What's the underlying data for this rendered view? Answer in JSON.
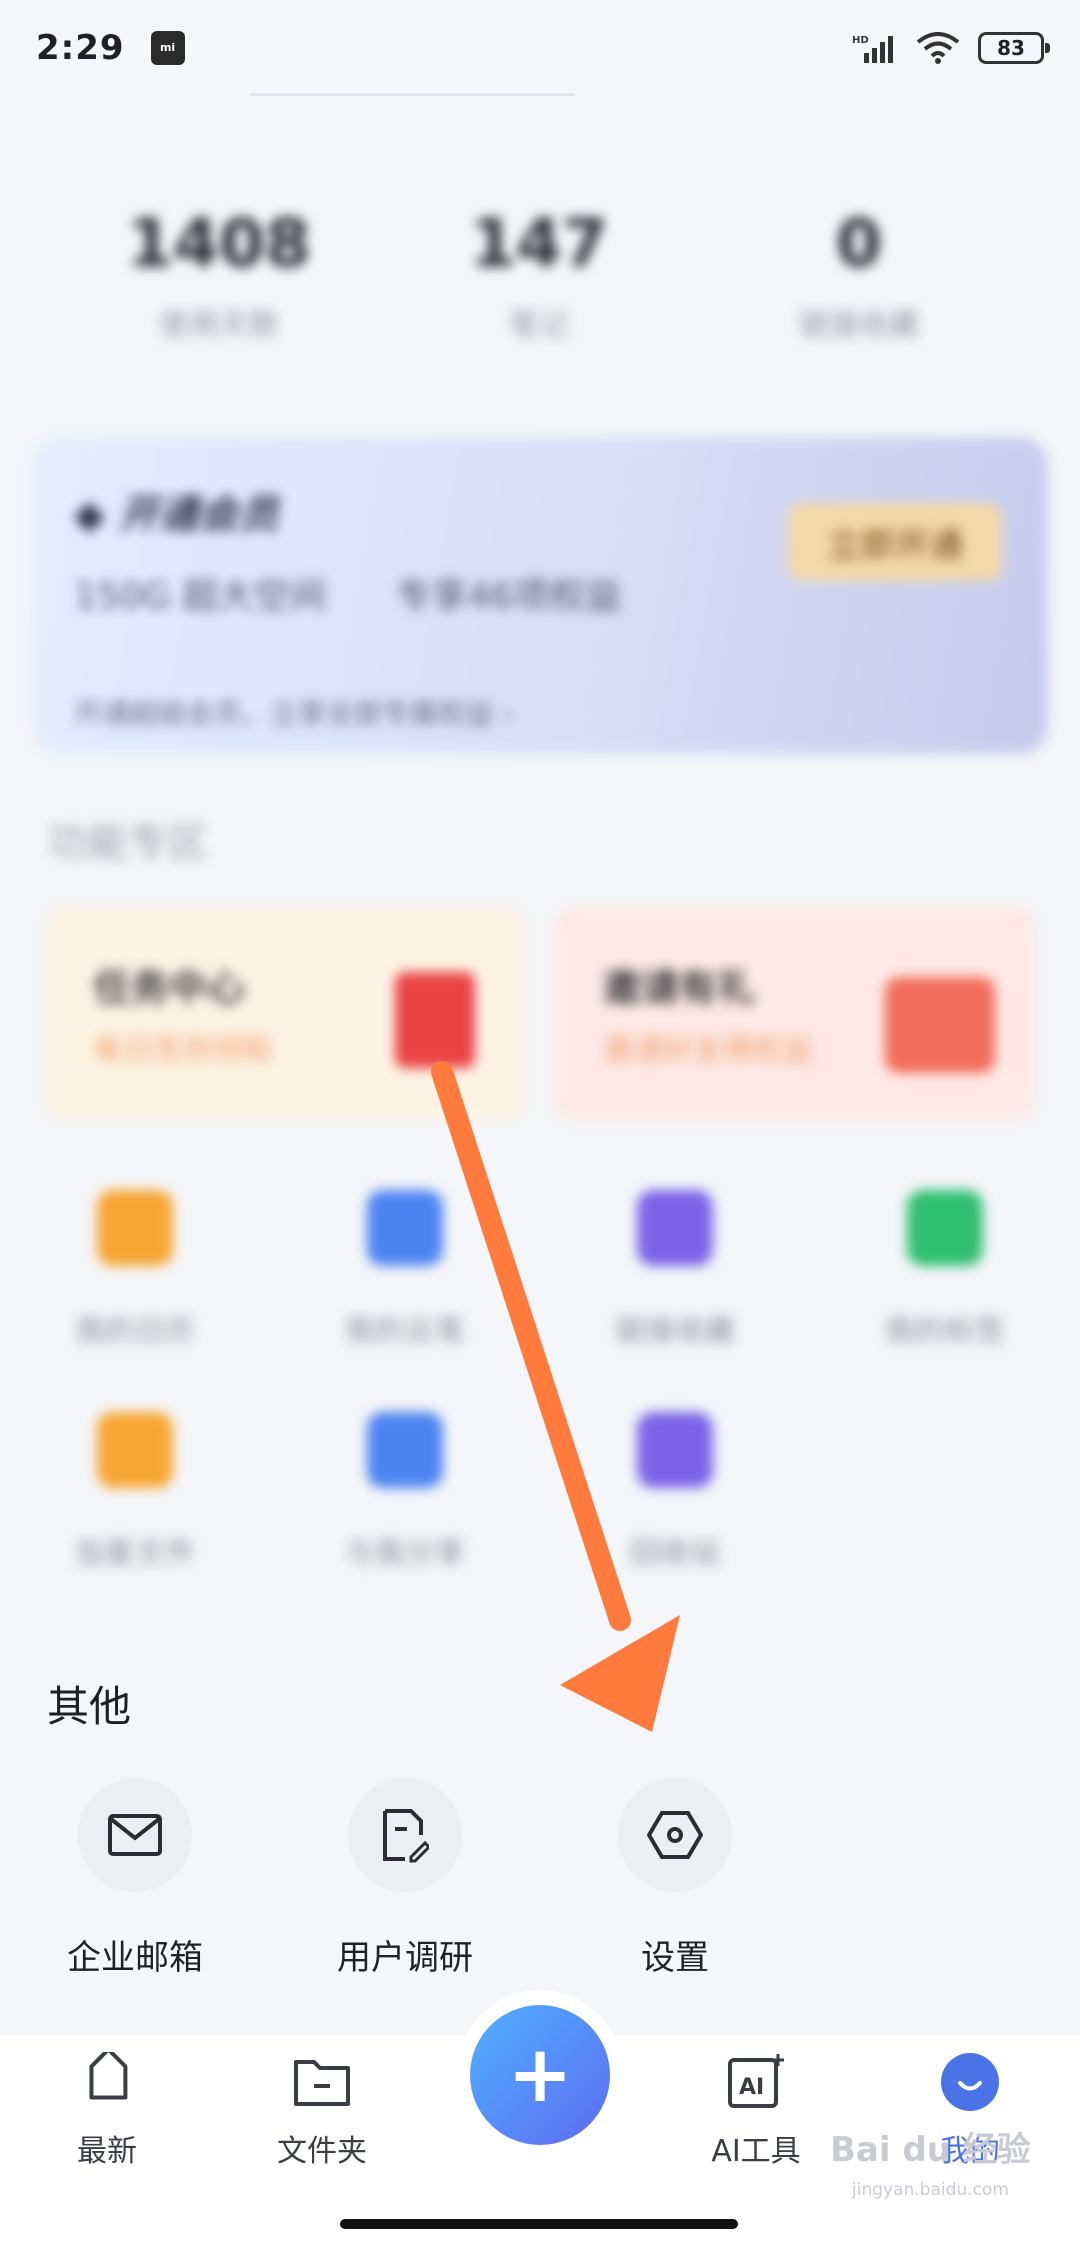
{
  "status_bar": {
    "time": "2:29",
    "mi_badge": "mi",
    "hd": "HD",
    "battery": "83"
  },
  "stats": [
    {
      "value": "1408",
      "label": "使用天数"
    },
    {
      "value": "147",
      "label": "笔记"
    },
    {
      "value": "0",
      "label": "链接收藏"
    }
  ],
  "vip": {
    "title": "开通会员",
    "desc_left": "150G 超大空间",
    "desc_right": "专享46项权益",
    "button": "立即开通",
    "footer": "开通超级会员，立享全部专属权益 ›"
  },
  "features_title": "功能专区",
  "promos": [
    {
      "title": "任务中心",
      "sub": "每日签到领取"
    },
    {
      "title": "邀请有礼",
      "sub": "邀请好友得权益"
    }
  ],
  "functions": [
    {
      "label": "我的日历",
      "icon": "calendar-icon",
      "color": "#f6a531"
    },
    {
      "label": "我的云笔",
      "icon": "pen-icon",
      "color": "#4b83f0"
    },
    {
      "label": "链接收藏",
      "icon": "star-icon",
      "color": "#7a63e8"
    },
    {
      "label": "我的标签",
      "icon": "bookmark-icon",
      "color": "#2fbf70"
    },
    {
      "label": "加星文件",
      "icon": "folder-star-icon",
      "color": "#f6a531"
    },
    {
      "label": "与我分享",
      "icon": "send-icon",
      "color": "#4b83f0"
    },
    {
      "label": "回收站",
      "icon": "trash-icon",
      "color": "#7a63e8"
    }
  ],
  "other": {
    "title": "其他",
    "items": [
      {
        "label": "企业邮箱",
        "icon": "mail-icon"
      },
      {
        "label": "用户调研",
        "icon": "survey-icon"
      },
      {
        "label": "设置",
        "icon": "settings-icon"
      }
    ]
  },
  "tabbar": {
    "tabs": [
      {
        "label": "最新",
        "icon": "tag-icon"
      },
      {
        "label": "文件夹",
        "icon": "folder-icon"
      },
      {
        "label": "AI工具",
        "icon": "ai-icon"
      },
      {
        "label": "我的",
        "icon": "profile-icon"
      }
    ],
    "fab": "+"
  },
  "watermark": {
    "main": "Bai du 经验",
    "sub": "jingyan.baidu.com"
  },
  "colors": {
    "accent": "#4a73e8",
    "arrow": "#ff7a3d",
    "background": "#f5f6f9"
  }
}
